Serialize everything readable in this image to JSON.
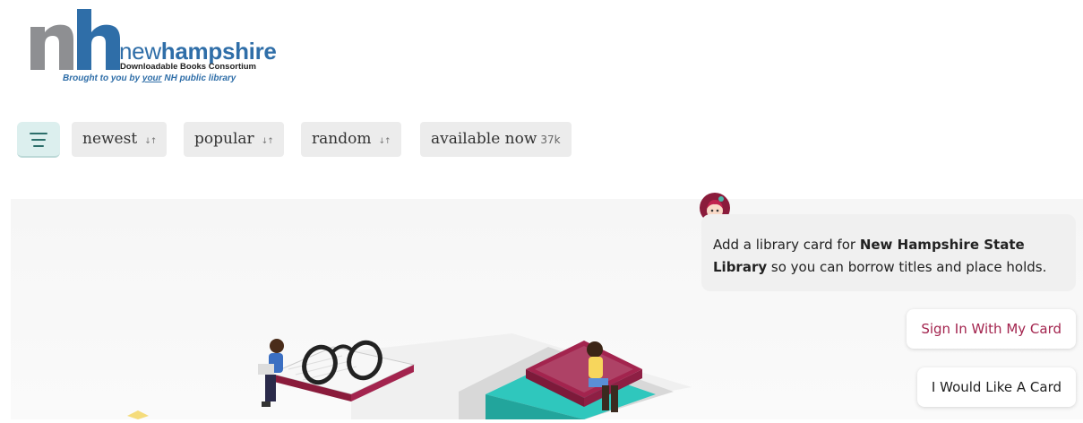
{
  "logo": {
    "letters": "nh",
    "word_light": "new",
    "word_bold": "hampshire",
    "subtitle": "Downloadable Books Consortium",
    "tagline_pre": "Brought to you by ",
    "tagline_emph": "your",
    "tagline_post": " NH public library"
  },
  "nav": {
    "menu_icon": "hamburger-icon",
    "pills": [
      {
        "label": "newest",
        "icon": "sort-arrows-icon",
        "sort_glyph": "↓↑"
      },
      {
        "label": "popular",
        "icon": "sort-arrows-icon",
        "sort_glyph": "↓↑"
      },
      {
        "label": "random",
        "icon": "sort-arrows-icon",
        "sort_glyph": "↓↑"
      },
      {
        "label": "available now",
        "count": "37k"
      }
    ]
  },
  "assistant": {
    "avatar_icon": "libby-avatar-icon",
    "message_pre": "Add a library card for ",
    "message_bold": "New Hampshire State Library",
    "message_post": " so you can borrow titles and place holds.",
    "buttons": {
      "sign_in": "Sign In With My Card",
      "want_card": "I Would Like A Card"
    }
  },
  "colors": {
    "brand_blue": "#2f6ea8",
    "accent_teal": "#dcefee",
    "sign_in_text": "#a3244e"
  }
}
